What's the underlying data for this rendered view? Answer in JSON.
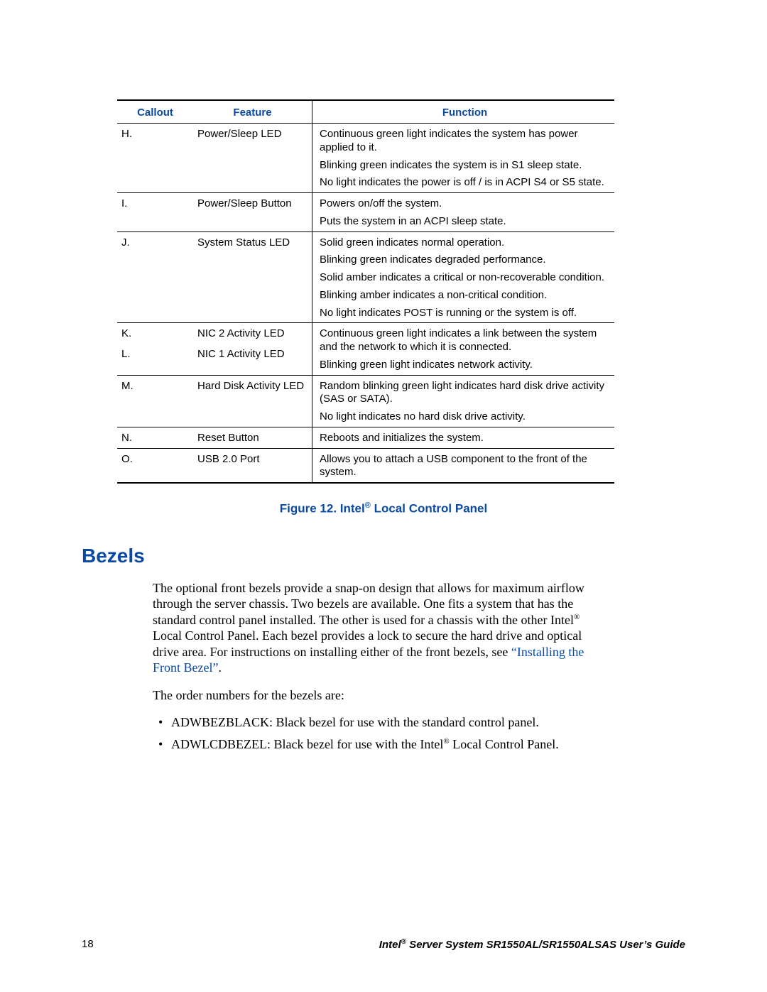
{
  "headers": {
    "callout": "Callout",
    "feature": "Feature",
    "function": "Function"
  },
  "rows": [
    {
      "callout": "H.",
      "feature": "Power/Sleep LED",
      "func": [
        "Continuous green light indicates the system has power applied to it.",
        "Blinking green indicates the system is in S1 sleep state.",
        "No light indicates the power is off / is in ACPI S4 or S5 state."
      ]
    },
    {
      "callout": "I.",
      "feature": "Power/Sleep Button",
      "func": [
        "Powers on/off the system.",
        "Puts the system in an ACPI sleep state."
      ]
    },
    {
      "callout": "J.",
      "feature": "System Status LED",
      "func": [
        "Solid green indicates normal operation.",
        "Blinking green indicates degraded performance.",
        "Solid amber indicates a critical or non-recoverable condition.",
        "Blinking amber indicates a non-critical condition.",
        "No light indicates POST is running or the system is off."
      ]
    },
    {
      "callout": "K.\nL.",
      "feature": "NIC 2 Activity LED\nNIC 1 Activity LED",
      "func": [
        "Continuous green light indicates a link between the system and the network to which it is connected.",
        "Blinking green light indicates network activity."
      ]
    },
    {
      "callout": "M.",
      "feature": "Hard Disk Activity LED",
      "func": [
        "Random blinking green light indicates hard disk drive activity (SAS or SATA).",
        "No light indicates no hard disk drive activity."
      ]
    },
    {
      "callout": "N.",
      "feature": "Reset Button",
      "func": [
        "Reboots and initializes the system."
      ]
    },
    {
      "callout": "O.",
      "feature": "USB 2.0 Port",
      "func": [
        "Allows you to attach a USB component to the front of the system."
      ]
    }
  ],
  "caption_pre": "Figure 12. Intel",
  "caption_post": " Local Control Panel",
  "section": "Bezels",
  "para1_a": "The optional front bezels provide a snap-on design that allows for maximum airflow through the server chassis. Two bezels are available. One fits a system that has the standard control panel installed. The other is used for a chassis with the other Intel",
  "para1_b": " Local Control Panel. Each bezel provides a lock to secure the hard drive and optical drive area. For instructions on installing either of the front bezels, see ",
  "link": "“Installing the Front Bezel”",
  "para1_c": ".",
  "para2": "The order numbers for the bezels are:",
  "bullet1": "ADWBEZBLACK: Black bezel for use with the standard control panel.",
  "bullet2_a": "ADWLCDBEZEL: Black bezel for use with the Intel",
  "bullet2_b": " Local Control Panel.",
  "page_num": "18",
  "footer_a": "Intel",
  "footer_b": " Server System SR1550AL/SR1550ALSAS User’s Guide",
  "reg": "®"
}
